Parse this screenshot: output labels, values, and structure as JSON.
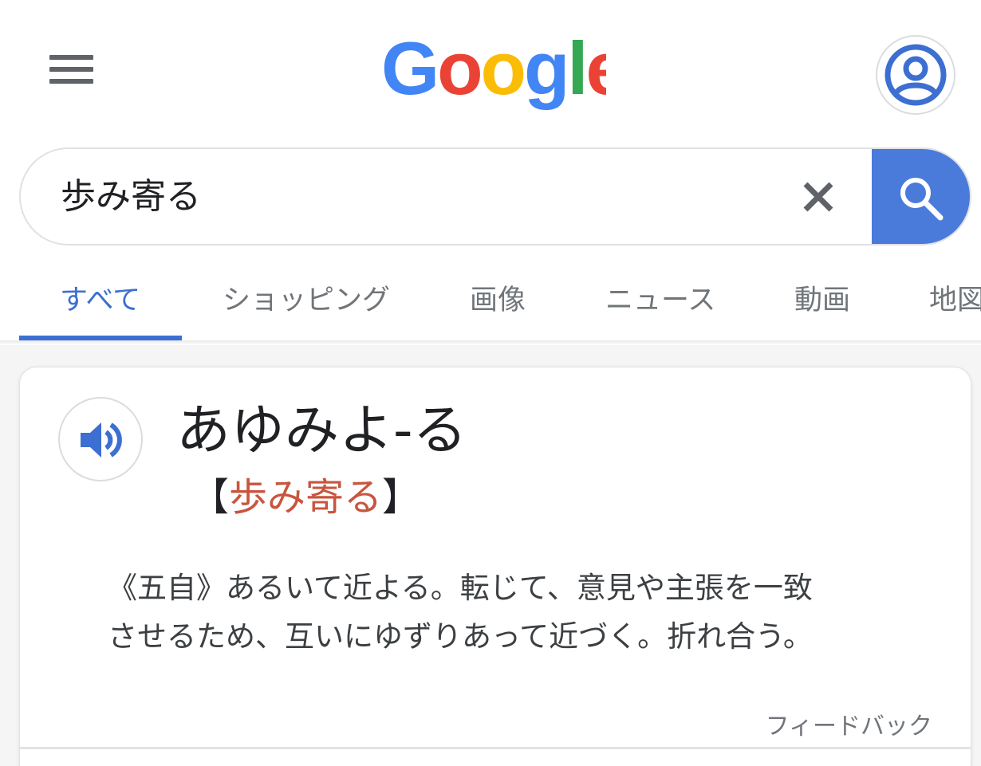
{
  "header": {
    "logo_text": "Google",
    "logo_colors": [
      "#4285F4",
      "#EA4335",
      "#FBBC05",
      "#4285F4",
      "#34A853",
      "#EA4335"
    ],
    "menu_icon": "hamburger-menu-icon",
    "account_icon": "account-circle-icon"
  },
  "search": {
    "query": "歩み寄る",
    "clear_icon": "close-icon",
    "search_icon": "search-icon",
    "accent_color": "#4a7bdb"
  },
  "tabs": [
    {
      "label": "すべて",
      "active": true
    },
    {
      "label": "ショッピング",
      "active": false
    },
    {
      "label": "画像",
      "active": false
    },
    {
      "label": "ニュース",
      "active": false
    },
    {
      "label": "動画",
      "active": false
    },
    {
      "label": "地図",
      "active": false
    }
  ],
  "dictionary": {
    "speaker_icon": "volume-up-icon",
    "reading": "あゆみよ-る",
    "bracket_open": "【",
    "kanji": "歩み寄る",
    "bracket_close": "】",
    "definition_lines": [
      "《五自》あるいて近よる。転じて、意見や主張を一致",
      "させるため、互いにゆずりあって近づく。折れ合う。"
    ],
    "feedback_label": "フィードバック",
    "kanji_color": "#c8553f"
  }
}
